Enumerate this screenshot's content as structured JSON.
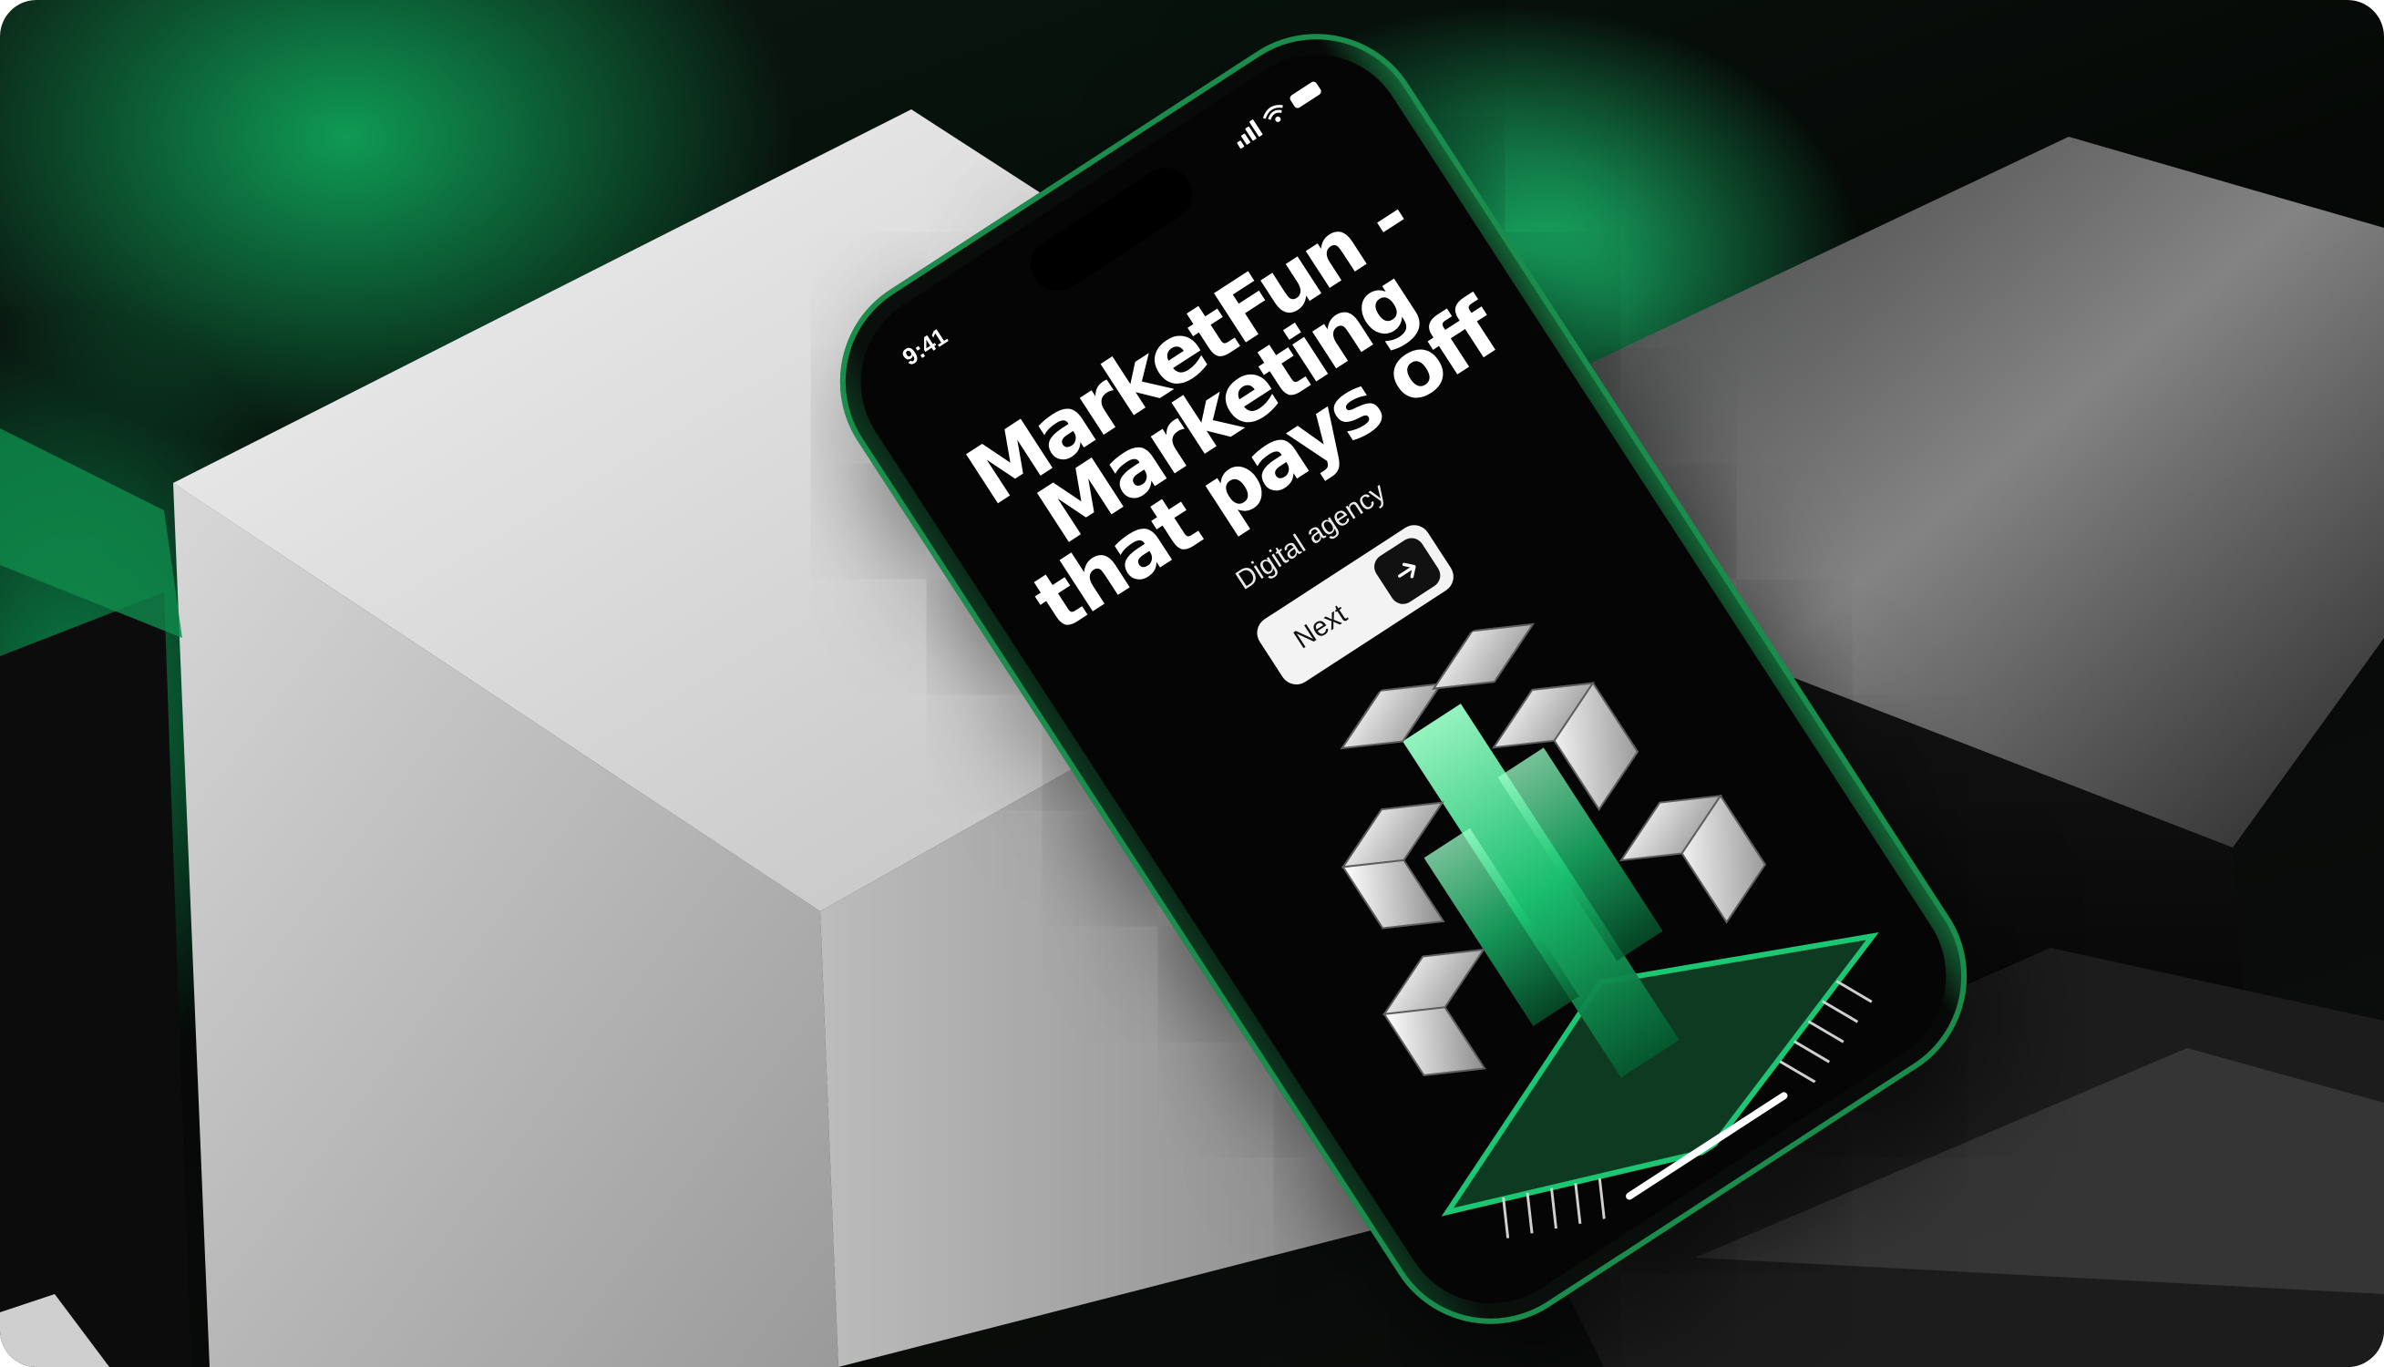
{
  "colors": {
    "accent_green": "#1cc774",
    "dark_background": "#050505",
    "button_light": "#f3f3f3",
    "text_white": "#ffffff"
  },
  "status_bar": {
    "time": "9:41",
    "icons": [
      "signal-icon",
      "wifi-icon",
      "battery-icon"
    ]
  },
  "hero": {
    "title_line_1": "MarketFun -",
    "title_line_2": "Marketing",
    "title_line_3": "that pays off",
    "subtitle": "Digital agency"
  },
  "cta": {
    "label": "Next",
    "icon": "arrow-right-icon"
  },
  "illustration": {
    "icon": "glowing-cube-chip-illustration"
  }
}
